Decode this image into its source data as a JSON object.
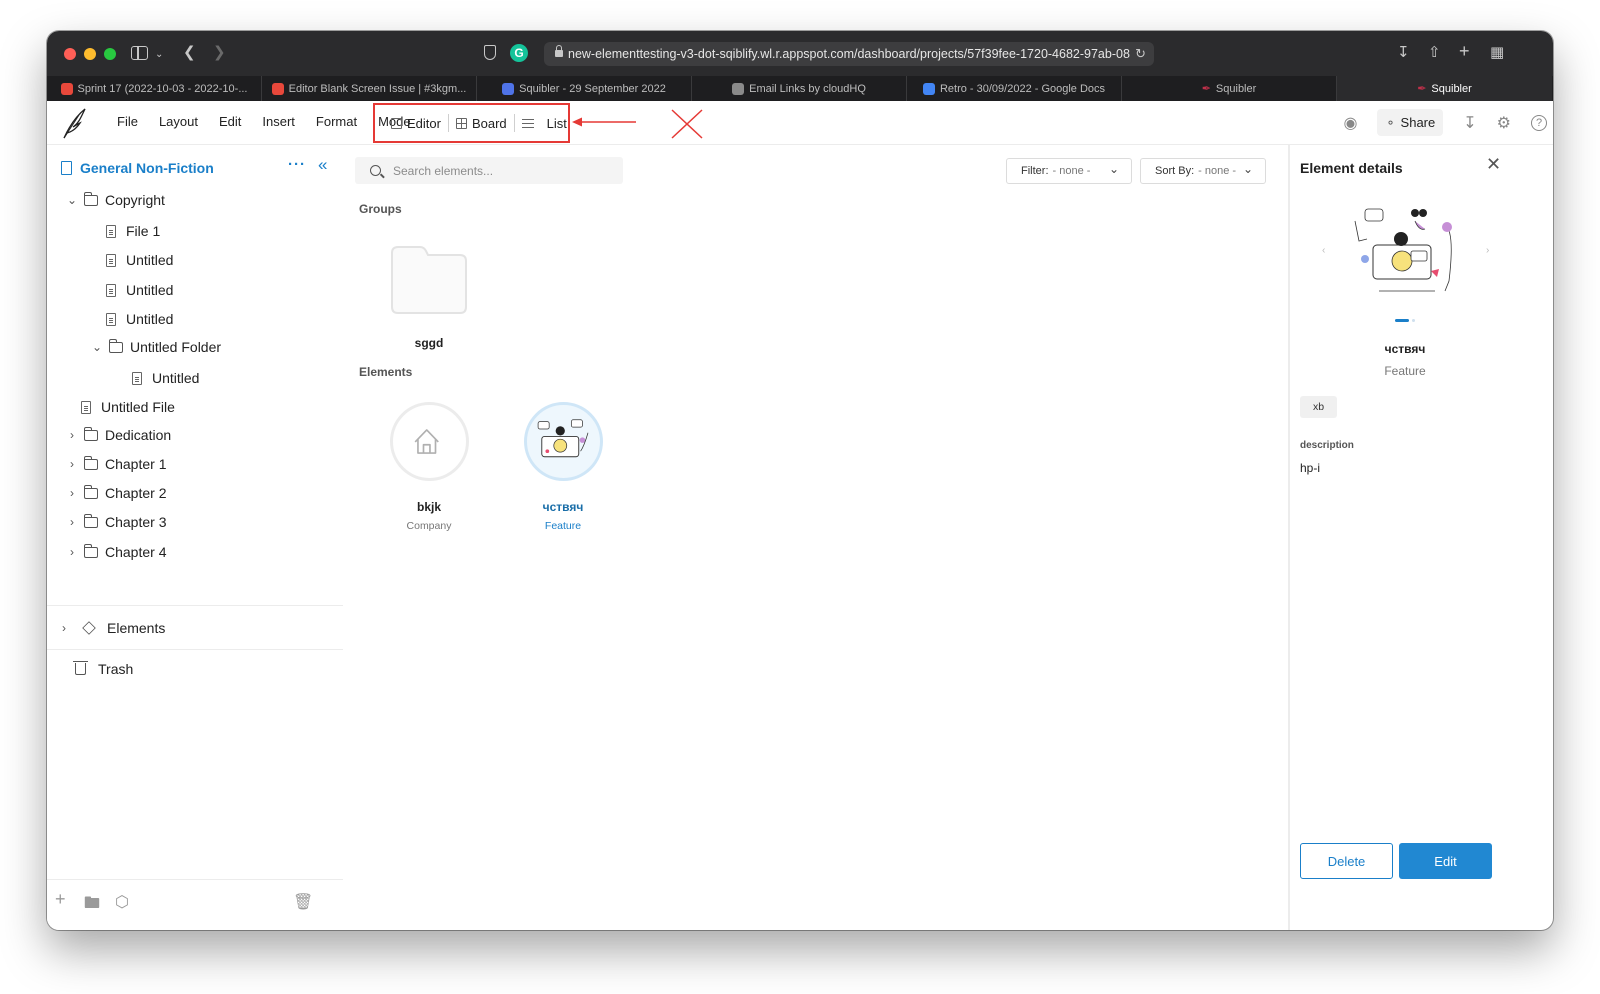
{
  "browser": {
    "url": "new-elementtesting-v3-dot-sqiblify.wl.r.appspot.com/dashboard/projects/57f39fee-1720-4682-97ab-08",
    "tabs": [
      {
        "label": "Sprint 17 (2022-10-03 - 2022-10-...",
        "icon_color": "#e8483b"
      },
      {
        "label": "Editor Blank Screen Issue | #3kgm...",
        "icon_color": "#e8483b"
      },
      {
        "label": "Squibler - 29 September 2022",
        "icon_color": "#4f73e8"
      },
      {
        "label": "Email Links by cloudHQ",
        "icon_color": "#8a8a8a"
      },
      {
        "label": "Retro - 30/09/2022 - Google Docs",
        "icon_color": "#4285f4"
      },
      {
        "label": "Squibler",
        "icon_color": "#c0304a"
      },
      {
        "label": "Squibler",
        "icon_color": "#c0304a",
        "active": true
      }
    ]
  },
  "menu": {
    "items": [
      "File",
      "Layout",
      "Edit",
      "Insert",
      "Format",
      "Mode"
    ]
  },
  "view_tabs": {
    "editor": "Editor",
    "board": "Board",
    "list": "List"
  },
  "toolbar": {
    "share_label": "Share"
  },
  "sidebar": {
    "project_title": "General Non-Fiction",
    "tree": {
      "copyright": "Copyright",
      "file1": "File 1",
      "untitled1": "Untitled",
      "untitled2": "Untitled",
      "untitled3": "Untitled",
      "untitled_folder": "Untitled Folder",
      "untitled4": "Untitled",
      "untitled_file": "Untitled File",
      "dedication": "Dedication",
      "chapter1": "Chapter 1",
      "chapter2": "Chapter 2",
      "chapter3": "Chapter 3",
      "chapter4": "Chapter 4"
    },
    "elements_label": "Elements",
    "trash_label": "Trash"
  },
  "main": {
    "search_placeholder": "Search elements...",
    "filter": {
      "label": "Filter:",
      "value": "- none -"
    },
    "sort": {
      "label": "Sort By:",
      "value": "- none -"
    },
    "groups_label": "Groups",
    "groups": [
      {
        "name": "sggd"
      }
    ],
    "elements_label": "Elements",
    "elements": [
      {
        "name": "bkjk",
        "type": "Company"
      },
      {
        "name": "чствяч",
        "type": "Feature"
      }
    ]
  },
  "details": {
    "title": "Element details",
    "name": "чствяч",
    "type": "Feature",
    "tag": "xb",
    "field_label": "description",
    "field_value": "hp-i",
    "delete_label": "Delete",
    "edit_label": "Edit"
  },
  "colors": {
    "accent": "#1a7fc9",
    "annotation": "#e53935"
  }
}
